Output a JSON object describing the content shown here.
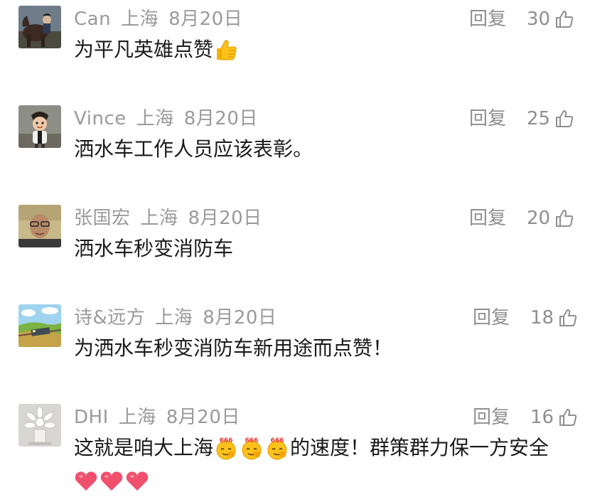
{
  "comments": [
    {
      "username": "Can",
      "location": "上海",
      "date": "8月20日",
      "reply_label": "回复",
      "likes": "30",
      "text": "为平凡英雄点赞",
      "emoji_after_text": "thumbs-up-emoji"
    },
    {
      "username": "Vince",
      "location": "上海",
      "date": "8月20日",
      "reply_label": "回复",
      "likes": "25",
      "text": "洒水车工作人员应该表彰。"
    },
    {
      "username": "张国宏",
      "location": "上海",
      "date": "8月20日",
      "reply_label": "回复",
      "likes": "20",
      "text": "洒水车秒变消防车"
    },
    {
      "username": "诗&远方",
      "location": "上海",
      "date": "8月20日",
      "reply_label": "回复",
      "likes": "18",
      "text": "为洒水车秒变消防车新用途而点赞！"
    },
    {
      "username": "DHI",
      "location": "上海",
      "date": "8月20日",
      "reply_label": "回复",
      "likes": "16",
      "text_part1": "这就是咱大上海",
      "emoji_666": "666",
      "text_part2": "的速度！群策群力保一方安全",
      "emoji_line2": "heart-emoji"
    }
  ],
  "colors": {
    "meta_text": "#9a9a9a",
    "body_text": "#1a1a1a",
    "heart": "#f0506e"
  },
  "icons": {
    "like": "thumbs-up-outline-icon"
  }
}
